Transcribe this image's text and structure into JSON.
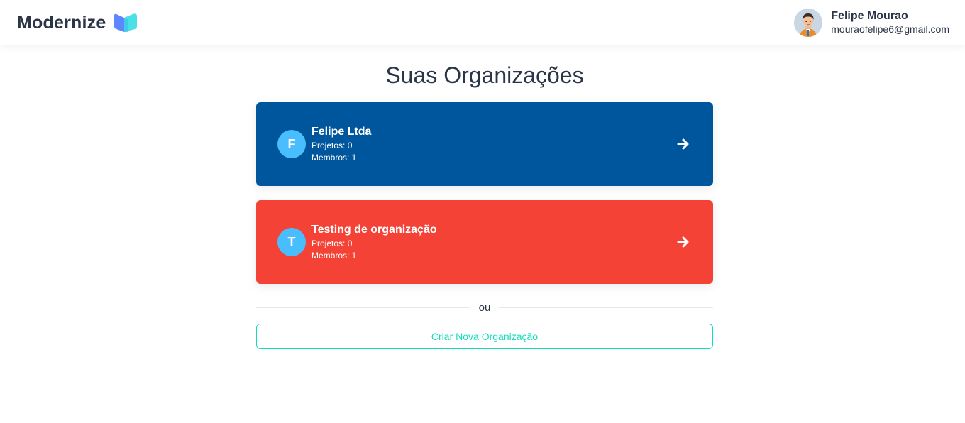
{
  "header": {
    "brand": "Modernize",
    "user": {
      "name": "Felipe Mourao",
      "email": "mouraofelipe6@gmail.com"
    }
  },
  "main": {
    "title": "Suas Organizações",
    "organizations": [
      {
        "initial": "F",
        "name": "Felipe Ltda",
        "projects": "Projetos: 0",
        "members": "Membros: 1",
        "color": "#00569d"
      },
      {
        "initial": "T",
        "name": "Testing de organização",
        "projects": "Projetos: 0",
        "members": "Membros: 1",
        "color": "#f44336"
      }
    ],
    "divider": "ou",
    "create_button": "Criar Nova Organização"
  },
  "icons": {
    "logo": "book-logo-icon",
    "arrow": "arrow-right-icon"
  },
  "colors": {
    "accent": "#13deb9",
    "initial_bg": "#49beff",
    "text": "#2a3547"
  }
}
